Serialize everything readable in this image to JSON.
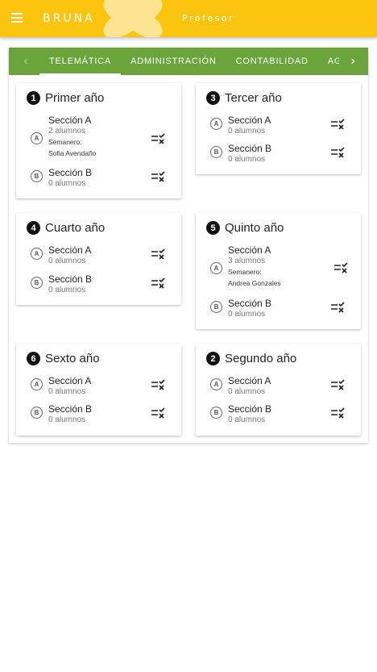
{
  "appbar": {
    "brand": "BRUNA",
    "role": "Profesor",
    "background": "#fbc50f",
    "menu_icon": "menu-icon"
  },
  "tabs": {
    "background": "#6ba43a",
    "items": [
      {
        "label": "TELEMÁTICA",
        "active": true
      },
      {
        "label": "ADMINISTRACIÓN",
        "active": false
      },
      {
        "label": "CONTABILIDAD",
        "active": false
      },
      {
        "label": "AGR",
        "active": false
      }
    ]
  },
  "cards": [
    {
      "number": "1",
      "title": "Primer año",
      "sections": [
        {
          "badge": "A",
          "name": "Sección A",
          "count": "2 alumnos",
          "weekly_label": "Semanero:",
          "weekly_name": "Sofia Avendaño"
        },
        {
          "badge": "B",
          "name": "Sección B",
          "count": "0 alumnos"
        }
      ]
    },
    {
      "number": "3",
      "title": "Tercer año",
      "sections": [
        {
          "badge": "A",
          "name": "Sección A",
          "count": "0 alumnos"
        },
        {
          "badge": "B",
          "name": "Sección B",
          "count": "0 alumnos"
        }
      ]
    },
    {
      "number": "4",
      "title": "Cuarto año",
      "sections": [
        {
          "badge": "A",
          "name": "Sección A",
          "count": "0 alumnos"
        },
        {
          "badge": "B",
          "name": "Sección B",
          "count": "0 alumnos"
        }
      ]
    },
    {
      "number": "5",
      "title": "Quinto año",
      "sections": [
        {
          "badge": "A",
          "name": "Sección A",
          "count": "3 alumnos",
          "weekly_label": "Semanero:",
          "weekly_name": "Andrea Gonzales"
        },
        {
          "badge": "B",
          "name": "Sección B",
          "count": "0 alumnos"
        }
      ]
    },
    {
      "number": "6",
      "title": "Sexto año",
      "sections": [
        {
          "badge": "A",
          "name": "Sección A",
          "count": "0 alumnos"
        },
        {
          "badge": "B",
          "name": "Sección B",
          "count": "0 alumnos"
        }
      ]
    },
    {
      "number": "2",
      "title": "Segundo año",
      "sections": [
        {
          "badge": "A",
          "name": "Sección A",
          "count": "0 alumnos"
        },
        {
          "badge": "B",
          "name": "Sección B",
          "count": "0 alumnos"
        }
      ]
    }
  ]
}
